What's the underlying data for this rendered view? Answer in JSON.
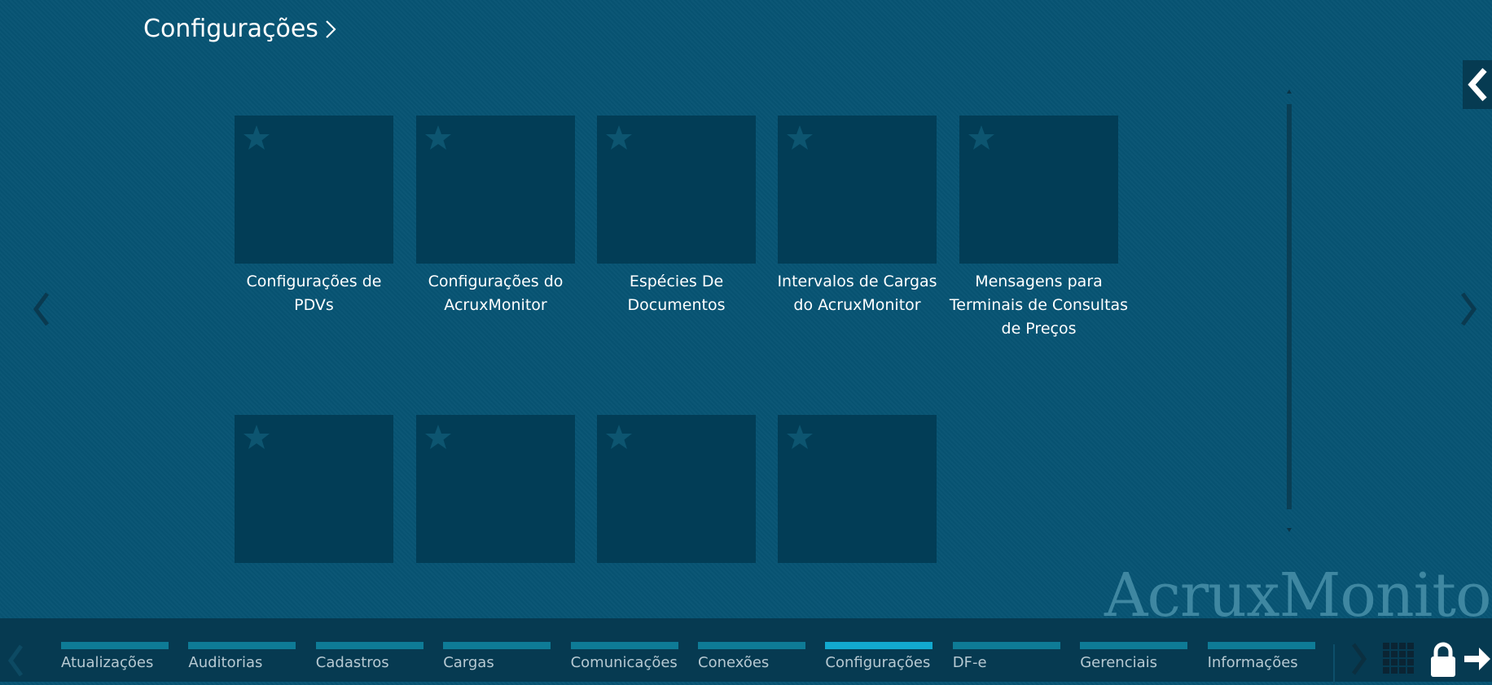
{
  "header": {
    "title": "Configurações"
  },
  "tiles": [
    {
      "label": "Configurações de PDVs"
    },
    {
      "label": "Configurações do AcruxMonitor"
    },
    {
      "label": "Espécies De Documentos"
    },
    {
      "label": "Intervalos de Cargas do AcruxMonitor"
    },
    {
      "label": "Mensagens para Terminais de Consultas de Preços"
    },
    {
      "label": ""
    },
    {
      "label": ""
    },
    {
      "label": ""
    },
    {
      "label": ""
    }
  ],
  "brand": {
    "watermark": "AcruxMonitor"
  },
  "taskbar": {
    "categories": [
      {
        "label": "Atualizações"
      },
      {
        "label": "Auditorias"
      },
      {
        "label": "Cadastros"
      },
      {
        "label": "Cargas"
      },
      {
        "label": "Comunicações"
      },
      {
        "label": "Conexões"
      },
      {
        "label": "Configurações",
        "active": true
      },
      {
        "label": "DF-e"
      },
      {
        "label": "Gerenciais"
      },
      {
        "label": "Informações"
      }
    ]
  },
  "icons": {
    "title_chevron": "chevron-right-icon",
    "collapse": "chevron-left-icon",
    "prev": "chevron-left-icon",
    "next": "chevron-right-icon",
    "star": "star-icon",
    "grid": "grid-icon",
    "lock": "lock-icon",
    "logout": "arrow-right-icon"
  },
  "colors": {
    "background": "#075473",
    "tile": "#023d56",
    "taskbar": "#063a51",
    "category_bar": "#0e7b96",
    "category_bar_active": "#12a9cf"
  }
}
